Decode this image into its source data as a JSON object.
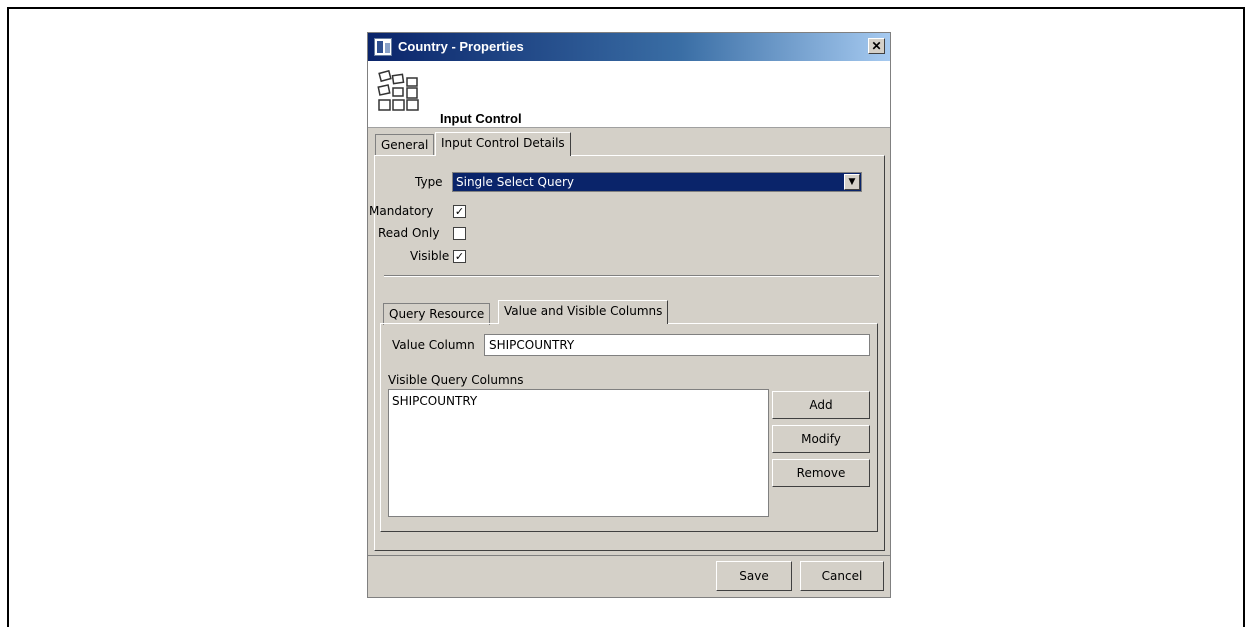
{
  "window": {
    "title": "Country - Properties",
    "close_glyph": "✕"
  },
  "header": {
    "title": "Input Control",
    "icon": "input-control-icon"
  },
  "tabs": [
    {
      "label": "General"
    },
    {
      "label": "Input Control Details",
      "active": true
    }
  ],
  "details": {
    "type_label": "Type",
    "type_value": "Single Select Query",
    "mandatory_label": "Mandatory",
    "mandatory": true,
    "read_only_label": "Read Only",
    "read_only": false,
    "visible_label": "Visible",
    "visible": true
  },
  "subtabs": [
    {
      "label": "Query Resource"
    },
    {
      "label": "Value and Visible Columns",
      "active": true
    }
  ],
  "columns": {
    "value_column_label": "Value Column",
    "value_column": "SHIPCOUNTRY",
    "visible_columns_label": "Visible Query Columns",
    "visible_columns": [
      "SHIPCOUNTRY"
    ],
    "add_label": "Add",
    "modify_label": "Modify",
    "remove_label": "Remove"
  },
  "footer": {
    "save_label": "Save",
    "cancel_label": "Cancel"
  },
  "colors": {
    "title_bar": "#0a246a",
    "dialog_bg": "#d4d0c8",
    "select_highlight": "#0a246a"
  }
}
